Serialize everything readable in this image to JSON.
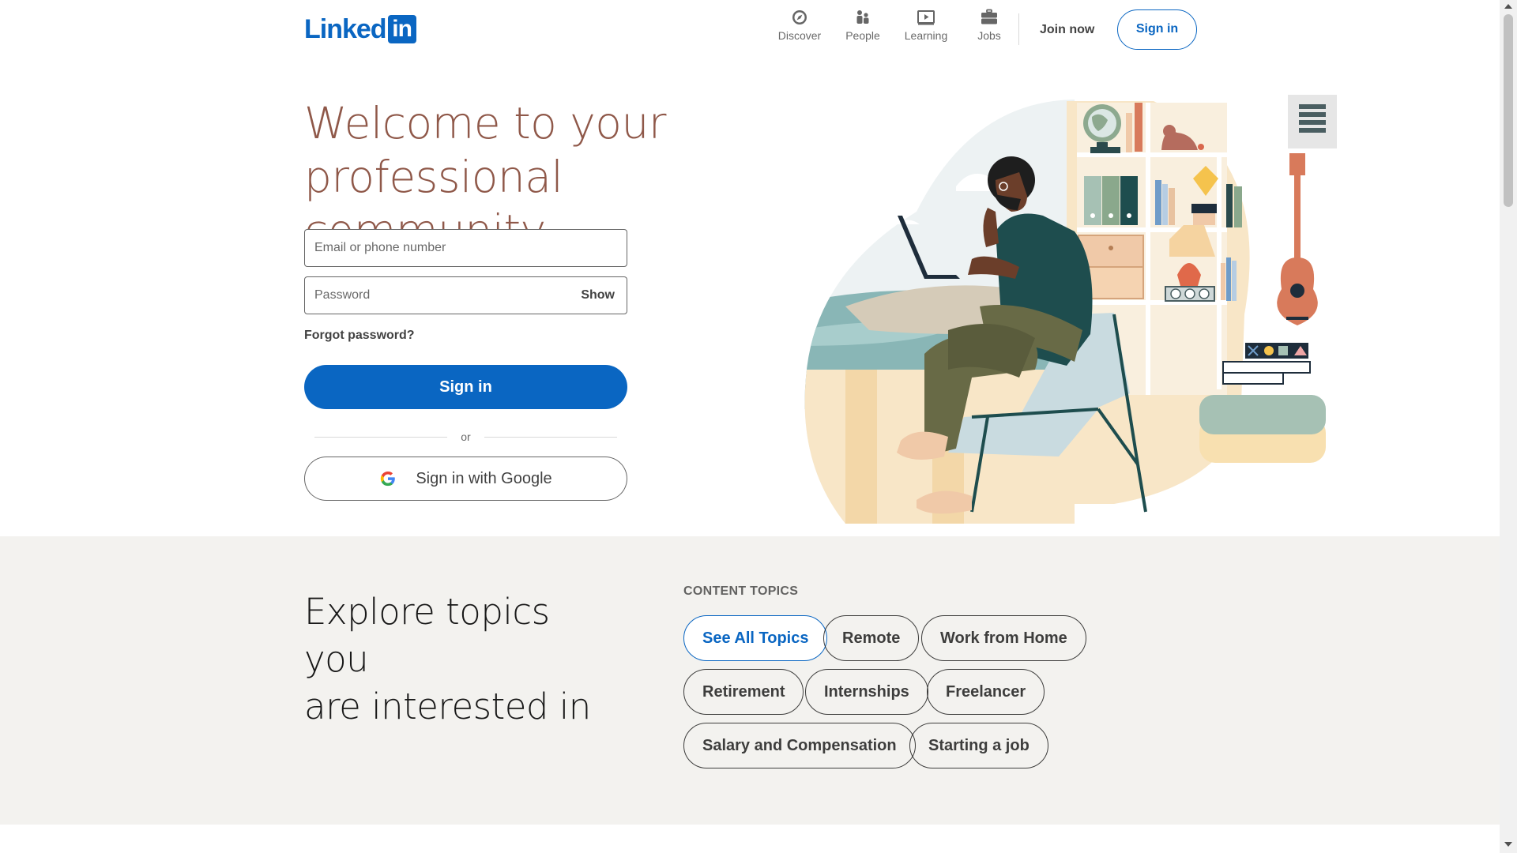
{
  "header": {
    "logo_text": "Linked",
    "logo_box": "in",
    "nav": [
      {
        "label": "Discover",
        "icon": "compass-icon"
      },
      {
        "label": "People",
        "icon": "people-icon"
      },
      {
        "label": "Learning",
        "icon": "video-play-icon"
      },
      {
        "label": "Jobs",
        "icon": "briefcase-icon"
      }
    ],
    "join_now": "Join now",
    "sign_in": "Sign in"
  },
  "hero": {
    "title_line1": "Welcome to your",
    "title_line2": "professional community",
    "email_placeholder": "Email or phone number",
    "password_placeholder": "Password",
    "show_label": "Show",
    "forgot_password": "Forgot password?",
    "sign_in_button": "Sign in",
    "or_text": "or",
    "google_button": "Sign in with Google"
  },
  "explore": {
    "title_line1": "Explore topics you",
    "title_line2": "are interested in",
    "topics_heading": "CONTENT TOPICS",
    "topics": [
      "See All Topics",
      "Remote",
      "Work from Home",
      "Retirement",
      "Internships",
      "Freelancer",
      "Salary and Compensation",
      "Starting a job"
    ]
  },
  "colors": {
    "brand": "#0a66c2",
    "hero_title": "#8f5849",
    "explore_bg": "#f3f2ef"
  }
}
